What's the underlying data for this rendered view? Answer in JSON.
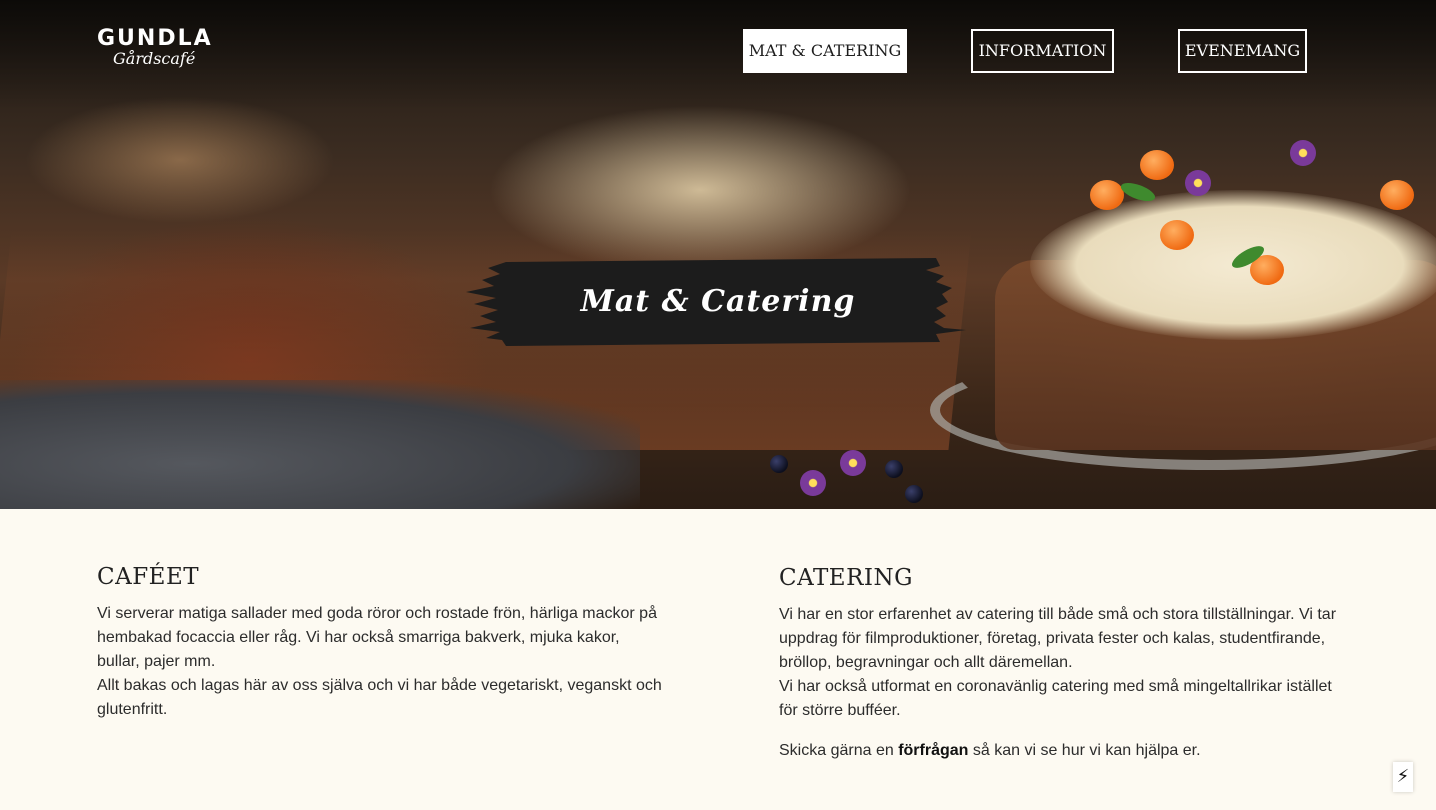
{
  "brand": {
    "name": "GUNDLA",
    "tagline": "Gårdscafé"
  },
  "nav": {
    "items": [
      {
        "label": "MAT & CATERING",
        "active": true
      },
      {
        "label": "INFORMATION",
        "active": false
      },
      {
        "label": "EVENEMANG",
        "active": false
      }
    ]
  },
  "hero": {
    "title": "Mat & Catering"
  },
  "cafe": {
    "heading": "CAFÉET",
    "paragraph1": "Vi serverar matiga sallader med goda röror och rostade frön, härliga mackor på hembakad focaccia eller råg. Vi har också smarriga bakverk, mjuka kakor, bullar, pajer mm.",
    "paragraph2": "Allt bakas och lagas här av oss själva och vi har både vegetariskt, veganskt och glutenfritt."
  },
  "catering": {
    "heading": "CATERING",
    "paragraph1": "Vi har en stor erfarenhet av catering till både små och stora tillställningar. Vi tar uppdrag för filmproduktioner, företag, privata fester och kalas, studentfirande, bröllop, begravningar och allt däremellan.",
    "paragraph2": "Vi har också utformat en coronavänlig catering med små mingeltallrikar istället för större bufféer.",
    "cta_before": "Skicka gärna en ",
    "cta_link": "förfrågan",
    "cta_after": " så kan vi se hur vi kan hjälpa er."
  },
  "widget": {
    "icon": "lightning-bolt-icon",
    "glyph": "⚡"
  },
  "colors": {
    "page_background": "#fdfaf2",
    "banner": "#1c1c1c",
    "text": "#262626"
  }
}
